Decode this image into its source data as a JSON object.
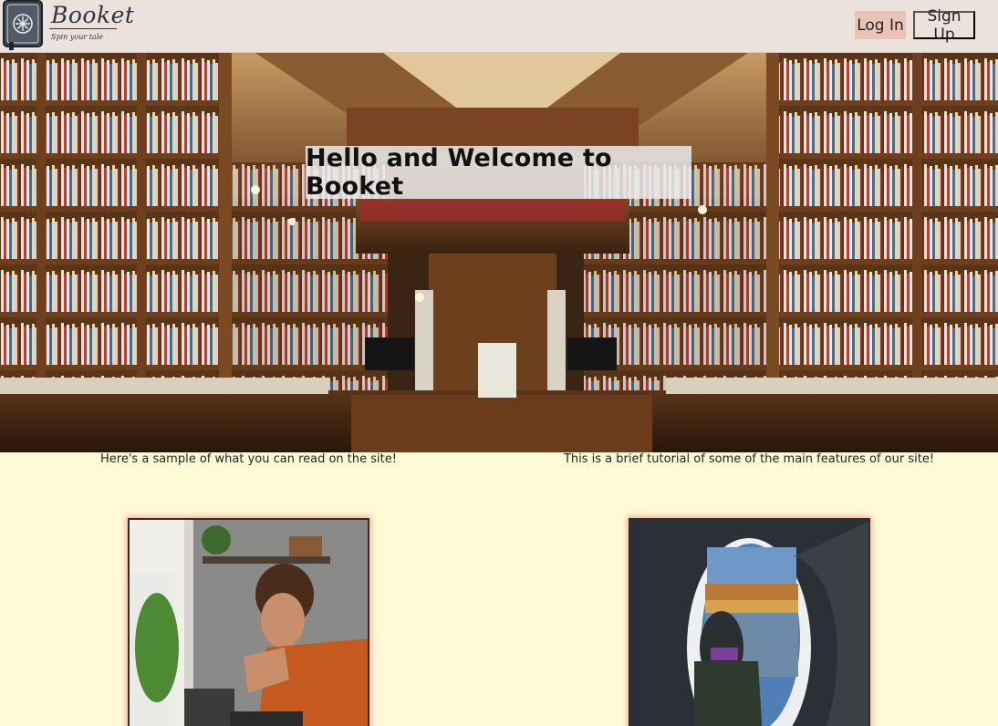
{
  "header": {
    "brand": "Booket",
    "tagline": "Spin your tale",
    "login_label": "Log In",
    "signup_label": "Sign Up"
  },
  "hero": {
    "title": "Hello and Welcome to Booket"
  },
  "sections": {
    "sample_caption": "Here's a sample of what you can read on the site!",
    "tutorial_caption": "This is a brief tutorial of some of the main features of our site!"
  },
  "colors": {
    "header_bg": "#ede1db",
    "login_bg": "#e9c4b6",
    "page_bg": "#fffad6"
  }
}
